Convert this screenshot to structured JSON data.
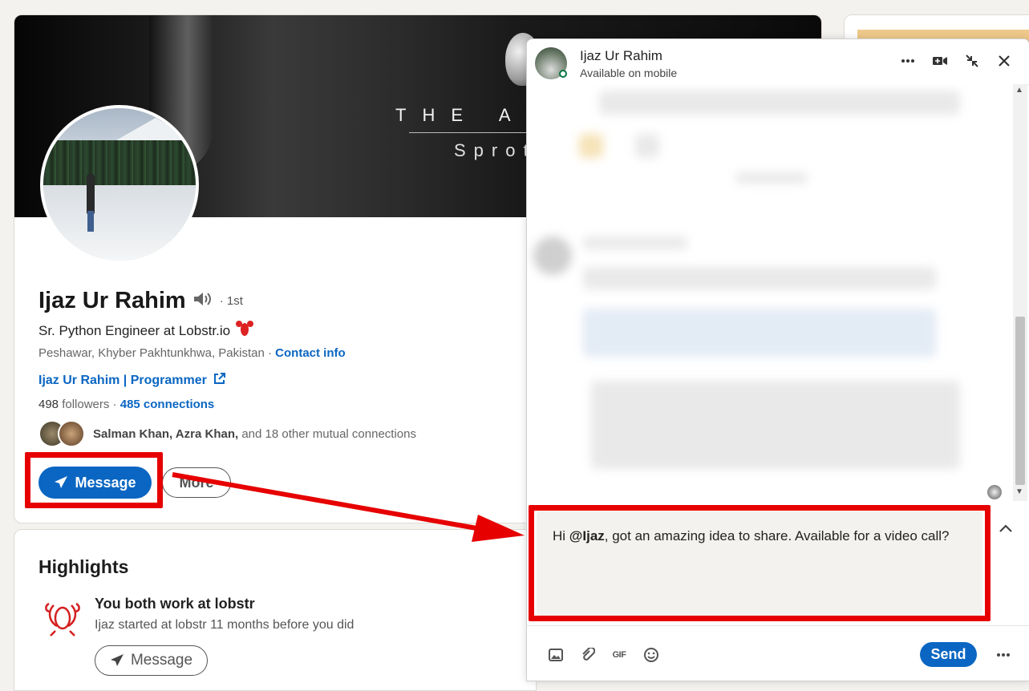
{
  "profile": {
    "banner_title": "THE A",
    "banner_subtitle": "Sprot",
    "name": "Ijaz Ur Rahim",
    "degree": "· 1st",
    "headline": "Sr. Python Engineer at Lobstr.io",
    "location": "Peshawar, Khyber Pakhtunkhwa, Pakistan ·",
    "contact_info": "Contact info",
    "website": "Ijaz Ur Rahim | Programmer",
    "followers_count": "498",
    "followers_label": "followers ·",
    "connections": "485 connections",
    "mutual_names": "Salman Khan, Azra Khan,",
    "mutual_rest": "and 18 other mutual connections",
    "message_button": "Message",
    "more_button": "More"
  },
  "highlights": {
    "title": "Highlights",
    "heading": "You both work at lobstr",
    "subtext": "Ijaz started at lobstr 11 months before you did",
    "message_button": "Message"
  },
  "chat": {
    "name": "Ijaz Ur Rahim",
    "status": "Available on mobile",
    "mention": "@Ijaz",
    "greeting": "Hi",
    "message_rest": ", got an amazing idea to share. Available for a video call?",
    "send_button": "Send",
    "gif_label": "GIF"
  },
  "icons": [
    "speaker-icon",
    "lobster-emoji-icon",
    "external-link-icon",
    "paper-plane-icon",
    "lobster-logo-icon",
    "more-icon",
    "video-call-icon",
    "minimize-icon",
    "close-icon",
    "image-icon",
    "attachment-icon",
    "gif-icon",
    "emoji-icon",
    "chevron-up-icon"
  ],
  "colors": {
    "brand_blue": "#0a66c2",
    "annotation_red": "#e60000",
    "compose_bg": "#f4f2ee",
    "online_green": "#057642"
  }
}
